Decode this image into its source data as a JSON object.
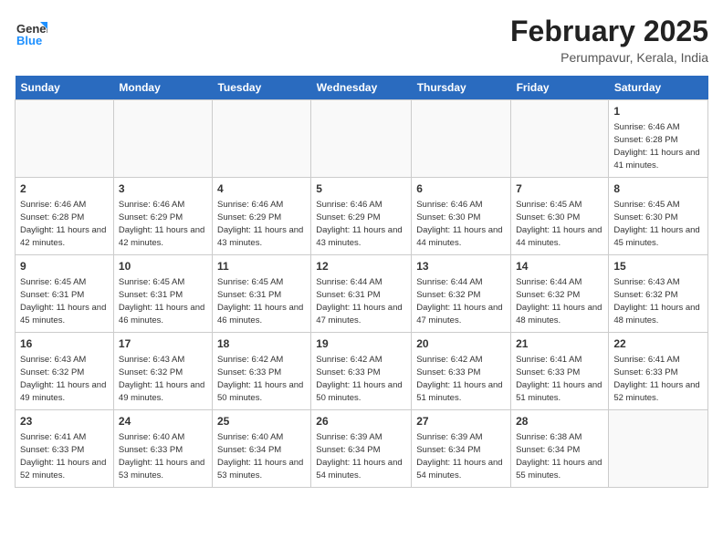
{
  "header": {
    "logo_general": "General",
    "logo_blue": "Blue",
    "month_year": "February 2025",
    "location": "Perumpavur, Kerala, India"
  },
  "days_of_week": [
    "Sunday",
    "Monday",
    "Tuesday",
    "Wednesday",
    "Thursday",
    "Friday",
    "Saturday"
  ],
  "weeks": [
    [
      {
        "day": "",
        "info": ""
      },
      {
        "day": "",
        "info": ""
      },
      {
        "day": "",
        "info": ""
      },
      {
        "day": "",
        "info": ""
      },
      {
        "day": "",
        "info": ""
      },
      {
        "day": "",
        "info": ""
      },
      {
        "day": "1",
        "info": "Sunrise: 6:46 AM\nSunset: 6:28 PM\nDaylight: 11 hours and 41 minutes."
      }
    ],
    [
      {
        "day": "2",
        "info": "Sunrise: 6:46 AM\nSunset: 6:28 PM\nDaylight: 11 hours and 42 minutes."
      },
      {
        "day": "3",
        "info": "Sunrise: 6:46 AM\nSunset: 6:29 PM\nDaylight: 11 hours and 42 minutes."
      },
      {
        "day": "4",
        "info": "Sunrise: 6:46 AM\nSunset: 6:29 PM\nDaylight: 11 hours and 43 minutes."
      },
      {
        "day": "5",
        "info": "Sunrise: 6:46 AM\nSunset: 6:29 PM\nDaylight: 11 hours and 43 minutes."
      },
      {
        "day": "6",
        "info": "Sunrise: 6:46 AM\nSunset: 6:30 PM\nDaylight: 11 hours and 44 minutes."
      },
      {
        "day": "7",
        "info": "Sunrise: 6:45 AM\nSunset: 6:30 PM\nDaylight: 11 hours and 44 minutes."
      },
      {
        "day": "8",
        "info": "Sunrise: 6:45 AM\nSunset: 6:30 PM\nDaylight: 11 hours and 45 minutes."
      }
    ],
    [
      {
        "day": "9",
        "info": "Sunrise: 6:45 AM\nSunset: 6:31 PM\nDaylight: 11 hours and 45 minutes."
      },
      {
        "day": "10",
        "info": "Sunrise: 6:45 AM\nSunset: 6:31 PM\nDaylight: 11 hours and 46 minutes."
      },
      {
        "day": "11",
        "info": "Sunrise: 6:45 AM\nSunset: 6:31 PM\nDaylight: 11 hours and 46 minutes."
      },
      {
        "day": "12",
        "info": "Sunrise: 6:44 AM\nSunset: 6:31 PM\nDaylight: 11 hours and 47 minutes."
      },
      {
        "day": "13",
        "info": "Sunrise: 6:44 AM\nSunset: 6:32 PM\nDaylight: 11 hours and 47 minutes."
      },
      {
        "day": "14",
        "info": "Sunrise: 6:44 AM\nSunset: 6:32 PM\nDaylight: 11 hours and 48 minutes."
      },
      {
        "day": "15",
        "info": "Sunrise: 6:43 AM\nSunset: 6:32 PM\nDaylight: 11 hours and 48 minutes."
      }
    ],
    [
      {
        "day": "16",
        "info": "Sunrise: 6:43 AM\nSunset: 6:32 PM\nDaylight: 11 hours and 49 minutes."
      },
      {
        "day": "17",
        "info": "Sunrise: 6:43 AM\nSunset: 6:32 PM\nDaylight: 11 hours and 49 minutes."
      },
      {
        "day": "18",
        "info": "Sunrise: 6:42 AM\nSunset: 6:33 PM\nDaylight: 11 hours and 50 minutes."
      },
      {
        "day": "19",
        "info": "Sunrise: 6:42 AM\nSunset: 6:33 PM\nDaylight: 11 hours and 50 minutes."
      },
      {
        "day": "20",
        "info": "Sunrise: 6:42 AM\nSunset: 6:33 PM\nDaylight: 11 hours and 51 minutes."
      },
      {
        "day": "21",
        "info": "Sunrise: 6:41 AM\nSunset: 6:33 PM\nDaylight: 11 hours and 51 minutes."
      },
      {
        "day": "22",
        "info": "Sunrise: 6:41 AM\nSunset: 6:33 PM\nDaylight: 11 hours and 52 minutes."
      }
    ],
    [
      {
        "day": "23",
        "info": "Sunrise: 6:41 AM\nSunset: 6:33 PM\nDaylight: 11 hours and 52 minutes."
      },
      {
        "day": "24",
        "info": "Sunrise: 6:40 AM\nSunset: 6:33 PM\nDaylight: 11 hours and 53 minutes."
      },
      {
        "day": "25",
        "info": "Sunrise: 6:40 AM\nSunset: 6:34 PM\nDaylight: 11 hours and 53 minutes."
      },
      {
        "day": "26",
        "info": "Sunrise: 6:39 AM\nSunset: 6:34 PM\nDaylight: 11 hours and 54 minutes."
      },
      {
        "day": "27",
        "info": "Sunrise: 6:39 AM\nSunset: 6:34 PM\nDaylight: 11 hours and 54 minutes."
      },
      {
        "day": "28",
        "info": "Sunrise: 6:38 AM\nSunset: 6:34 PM\nDaylight: 11 hours and 55 minutes."
      },
      {
        "day": "",
        "info": ""
      }
    ]
  ]
}
